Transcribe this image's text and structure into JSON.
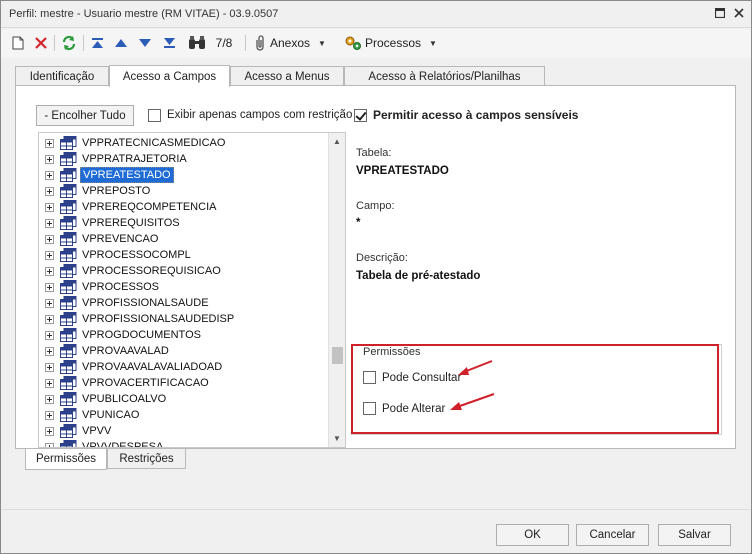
{
  "window": {
    "title": "Perfil: mestre - Usuario mestre (RM VITAE) - 03.9.0507"
  },
  "toolbar": {
    "record_position": "7/8",
    "attachments_label": "Anexos",
    "processes_label": "Processos"
  },
  "tabs": [
    {
      "label": "Identificação"
    },
    {
      "label": "Acesso a Campos"
    },
    {
      "label": "Acesso a Menus"
    },
    {
      "label": "Acesso à Relatórios/Planilhas"
    }
  ],
  "panel": {
    "collapse_all_label": "- Encolher Tudo",
    "only_restricted_label": "Exibir apenas campos com restrição",
    "only_restricted_checked": false,
    "allow_sensitive_label": "Permitir acesso à campos sensíveis",
    "allow_sensitive_checked": true
  },
  "tree": {
    "items": [
      {
        "label": "VPPRATECNICASMEDICAO"
      },
      {
        "label": "VPPRATRAJETORIA"
      },
      {
        "label": "VPREATESTADO",
        "selected": true
      },
      {
        "label": "VPREPOSTO"
      },
      {
        "label": "VPREREQCOMPETENCIA"
      },
      {
        "label": "VPREREQUISITOS"
      },
      {
        "label": "VPREVENCAO"
      },
      {
        "label": "VPROCESSOCOMPL"
      },
      {
        "label": "VPROCESSOREQUISICAO"
      },
      {
        "label": "VPROCESSOS"
      },
      {
        "label": "VPROFISSIONALSAUDE"
      },
      {
        "label": "VPROFISSIONALSAUDEDISP"
      },
      {
        "label": "VPROGDOCUMENTOS"
      },
      {
        "label": "VPROVAAVALAD"
      },
      {
        "label": "VPROVAAVALAVALIADOAD"
      },
      {
        "label": "VPROVACERTIFICACAO"
      },
      {
        "label": "VPUBLICOALVO"
      },
      {
        "label": "VPUNICAO"
      },
      {
        "label": "VPVV"
      },
      {
        "label": "VPVVDESPESA"
      }
    ]
  },
  "details": {
    "table_label": "Tabela:",
    "table_value": "VPREATESTADO",
    "field_label": "Campo:",
    "field_value": "*",
    "description_label": "Descrição:",
    "description_value": "Tabela de pré-atestado"
  },
  "permissions": {
    "group_label": "Permissões",
    "can_view_label": "Pode Consultar",
    "can_view_checked": false,
    "can_edit_label": "Pode Alterar",
    "can_edit_checked": false,
    "annotation_color": "#d0202a"
  },
  "bottom_tabs": [
    {
      "label": "Permissões"
    },
    {
      "label": "Restrições"
    }
  ],
  "footer": {
    "ok_label": "OK",
    "cancel_label": "Cancelar",
    "save_label": "Salvar"
  }
}
